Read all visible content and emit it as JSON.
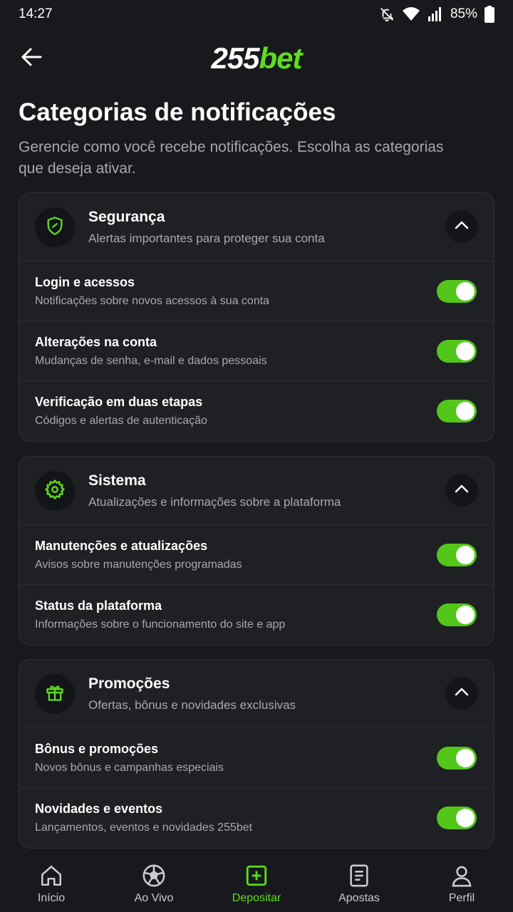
{
  "status": {
    "time": "14:27",
    "battery": "85%"
  },
  "header": {
    "logo_num": "255",
    "logo_bet": "bet"
  },
  "page": {
    "title": "Categorias de notificações",
    "description": "Gerencie como você recebe notificações. Escolha as categorias que deseja ativar."
  },
  "categories": [
    {
      "title": "Segurança",
      "subtitle": "Alertas importantes para proteger sua conta",
      "icon": "shield-icon",
      "expanded": true,
      "items": [
        {
          "title": "Login e acessos",
          "subtitle": "Notificações sobre novos acessos à sua conta",
          "enabled": true
        },
        {
          "title": "Alterações na conta",
          "subtitle": "Mudanças de senha, e-mail e dados pessoais",
          "enabled": true
        },
        {
          "title": "Verificação em duas etapas",
          "subtitle": "Códigos e alertas de autenticação",
          "enabled": true
        }
      ]
    },
    {
      "title": "Sistema",
      "subtitle": "Atualizações e informações sobre a plataforma",
      "icon": "gear-icon",
      "expanded": true,
      "items": [
        {
          "title": "Manutenções e atualizações",
          "subtitle": "Avisos sobre manutenções programadas",
          "enabled": true
        },
        {
          "title": "Status da plataforma",
          "subtitle": "Informações sobre o funcionamento do site e app",
          "enabled": true
        }
      ]
    },
    {
      "title": "Promoções",
      "subtitle": "Ofertas, bônus e novidades exclusivas",
      "icon": "gift-icon",
      "expanded": true,
      "items": [
        {
          "title": "Bônus e promoções",
          "subtitle": "Novos bônus e campanhas especiais",
          "enabled": true
        },
        {
          "title": "Novidades e eventos",
          "subtitle": "Lançamentos, eventos e novidades 255bet",
          "enabled": true
        }
      ]
    }
  ],
  "nav": [
    {
      "label": "Início",
      "icon": "home-icon",
      "active": false
    },
    {
      "label": "Ao Vivo",
      "icon": "soccer-ball-icon",
      "active": false
    },
    {
      "label": "Depositar",
      "icon": "plus-square-icon",
      "active": true
    },
    {
      "label": "Apostas",
      "icon": "document-icon",
      "active": false
    },
    {
      "label": "Perfil",
      "icon": "user-icon",
      "active": false
    }
  ],
  "colors": {
    "accent": "#5fdc1f",
    "toggle_on": "#53c61a",
    "background": "#17191c",
    "card": "#1e2024"
  }
}
